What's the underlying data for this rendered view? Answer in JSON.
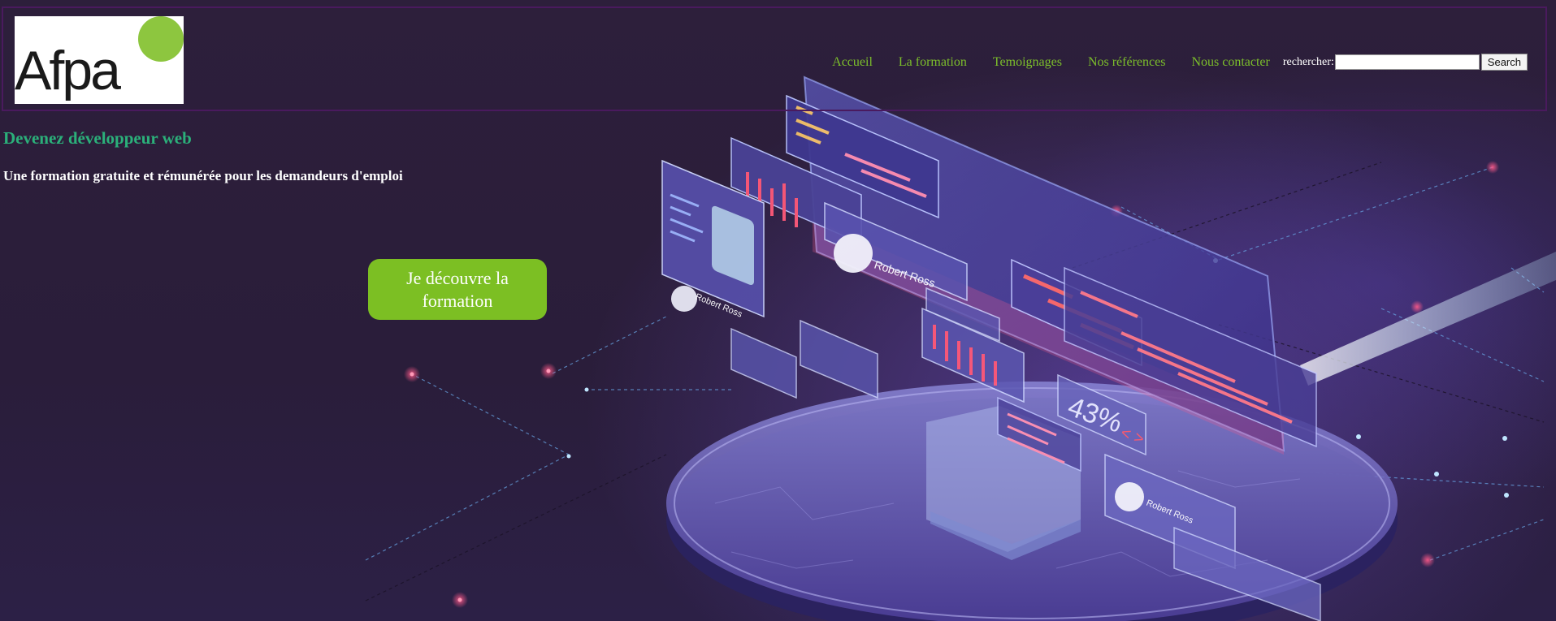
{
  "header": {
    "logo_text": "Afpa",
    "nav": [
      {
        "label": "Accueil"
      },
      {
        "label": "La formation"
      },
      {
        "label": "Temoignages"
      },
      {
        "label": "Nos références"
      },
      {
        "label": "Nous contacter"
      }
    ],
    "search": {
      "label": "rechercher:",
      "value": "",
      "button_label": "Search"
    }
  },
  "hero": {
    "title": "Devenez développeur web",
    "subtitle": "Une formation gratuite et rémunérée pour les demandeurs d'emploi",
    "cta_label": "Je découvre la formation"
  },
  "illustration": {
    "percent_label": "43%",
    "code_glyph": "< >",
    "card_names": [
      "Robert Ross",
      "Robert Ross",
      "Robert Ross"
    ]
  },
  "colors": {
    "nav_link": "#7cbf2b",
    "title": "#2bb07a",
    "cta": "#7cbf23",
    "logo_dot": "#8dc63f",
    "header_border": "#4a1a5e"
  }
}
